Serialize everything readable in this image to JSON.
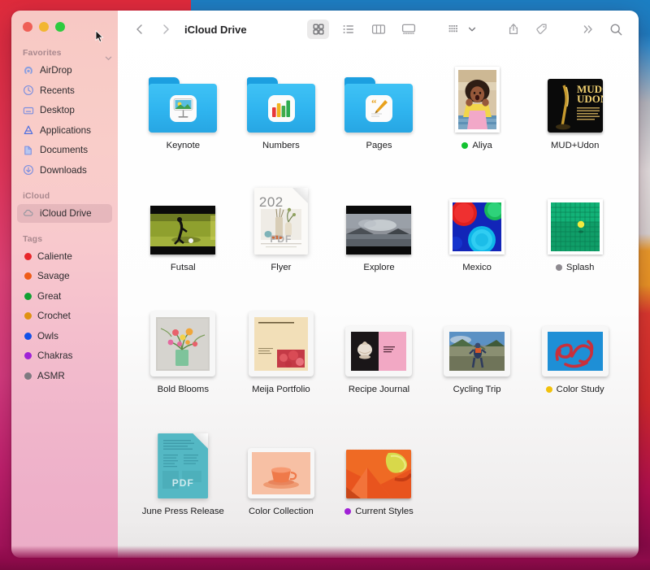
{
  "window": {
    "title": "iCloud Drive",
    "traffic_lights": [
      "close",
      "minimize",
      "zoom"
    ]
  },
  "toolbar": {
    "back_label": "Back",
    "forward_label": "Forward",
    "view_modes": [
      {
        "name": "icon-view",
        "label": "Icon View",
        "selected": true
      },
      {
        "name": "list-view",
        "label": "List View",
        "selected": false
      },
      {
        "name": "column-view",
        "label": "Column View",
        "selected": false
      },
      {
        "name": "gallery-view",
        "label": "Gallery View",
        "selected": false
      }
    ],
    "group_by_label": "Group By",
    "share_label": "Share",
    "tag_label": "Tags",
    "more_label": "More",
    "search_label": "Search"
  },
  "sidebar": {
    "sections": [
      {
        "title": "Favorites",
        "items": [
          {
            "label": "AirDrop",
            "icon": "airdrop-icon"
          },
          {
            "label": "Recents",
            "icon": "clock-icon"
          },
          {
            "label": "Desktop",
            "icon": "desktop-icon"
          },
          {
            "label": "Applications",
            "icon": "applications-icon"
          },
          {
            "label": "Documents",
            "icon": "documents-icon"
          },
          {
            "label": "Downloads",
            "icon": "downloads-icon"
          }
        ]
      },
      {
        "title": "iCloud",
        "items": [
          {
            "label": "iCloud Drive",
            "icon": "cloud-icon",
            "active": true
          }
        ]
      },
      {
        "title": "Tags",
        "items": [
          {
            "label": "Caliente",
            "icon": "tag-dot",
            "color": "#e8262b"
          },
          {
            "label": "Savage",
            "icon": "tag-dot",
            "color": "#ef5b18"
          },
          {
            "label": "Great",
            "icon": "tag-dot",
            "color": "#12a033"
          },
          {
            "label": "Crochet",
            "icon": "tag-dot",
            "color": "#e09112"
          },
          {
            "label": "Owls",
            "icon": "tag-dot",
            "color": "#1350e8"
          },
          {
            "label": "Chakras",
            "icon": "tag-dot",
            "color": "#a021d6"
          },
          {
            "label": "ASMR",
            "icon": "tag-dot",
            "color": "#7e7a80"
          }
        ]
      }
    ]
  },
  "files": [
    {
      "name": "Keynote",
      "kind": "folder",
      "app": "keynote",
      "tag": null
    },
    {
      "name": "Numbers",
      "kind": "folder",
      "app": "numbers",
      "tag": null
    },
    {
      "name": "Pages",
      "kind": "folder",
      "app": "pages",
      "tag": null
    },
    {
      "name": "Aliya",
      "kind": "photo-portrait",
      "art": "girl-portrait",
      "tag": "#12c230"
    },
    {
      "name": "MUD+Udon",
      "kind": "image",
      "art": "mud-udon-poster",
      "tag": null
    },
    {
      "name": "Futsal",
      "kind": "video",
      "art": "futsal-field",
      "tag": null
    },
    {
      "name": "Flyer",
      "kind": "pdf",
      "art": "flyer-vase",
      "badge": "PDF",
      "year": "202",
      "tag": null
    },
    {
      "name": "Explore",
      "kind": "video",
      "art": "explore-landscape",
      "tag": null
    },
    {
      "name": "Mexico",
      "kind": "photo-square",
      "art": "mexico-circles",
      "tag": null
    },
    {
      "name": "Splash",
      "kind": "photo-square",
      "art": "splash-grid",
      "tag": "#8e8a90"
    },
    {
      "name": "Bold Blooms",
      "kind": "document",
      "art": "bold-blooms",
      "tag": null
    },
    {
      "name": "Meija Portfolio",
      "kind": "document",
      "art": "meija-portfolio",
      "tag": null
    },
    {
      "name": "Recipe Journal",
      "kind": "document",
      "art": "recipe-journal",
      "tag": null
    },
    {
      "name": "Cycling Trip",
      "kind": "document",
      "art": "cycling-trip",
      "tag": null
    },
    {
      "name": "Color Study",
      "kind": "document",
      "art": "color-study",
      "tag": "#f2c10b"
    },
    {
      "name": "June Press Release",
      "kind": "pdf-teal",
      "badge": "PDF",
      "tag": null
    },
    {
      "name": "Color Collection",
      "kind": "doc-land",
      "art": "orange-cup",
      "tag": null
    },
    {
      "name": "Current Styles",
      "kind": "image-land",
      "art": "orange-abstract",
      "tag": "#a021d6"
    }
  ],
  "colors": {
    "folder_blue": "#2fb4ef",
    "sidebar_pink": "#f8cbc6",
    "selected_gray": "#ebeaea"
  }
}
